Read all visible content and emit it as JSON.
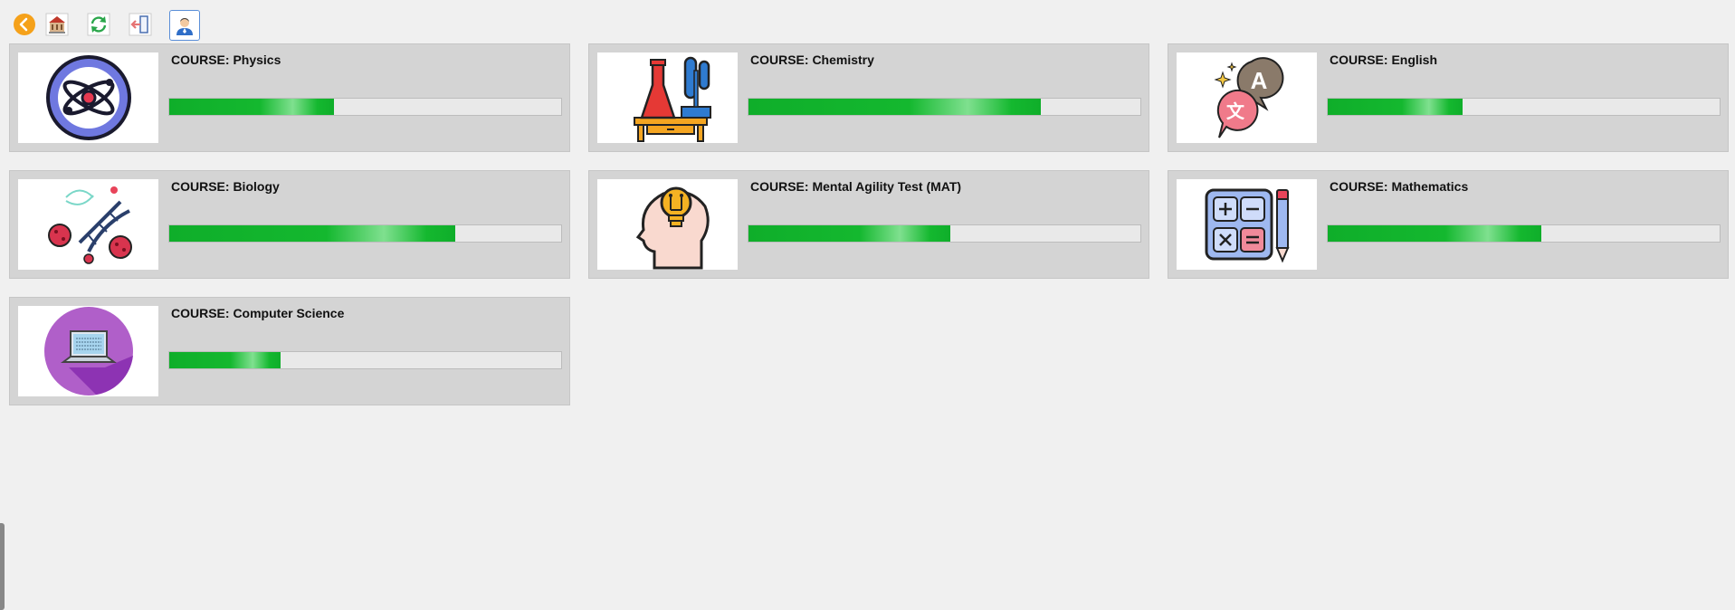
{
  "toolbar": {
    "buttons": [
      {
        "name": "back-button",
        "icon": "back-arrow-icon",
        "color": "#f5a11a"
      },
      {
        "name": "home-button",
        "icon": "school-building-icon",
        "color": "#c0392b"
      },
      {
        "name": "refresh-button",
        "icon": "refresh-icon",
        "color": "#2aa64a"
      },
      {
        "name": "logout-button",
        "icon": "exit-door-icon",
        "color": "#e57373"
      },
      {
        "name": "profile-button",
        "icon": "user-avatar-icon",
        "color": "#2f6ec8"
      }
    ]
  },
  "courses": [
    {
      "label": "COURSE: Physics",
      "icon": "atom-icon",
      "progress": 0.42
    },
    {
      "label": "COURSE: Chemistry",
      "icon": "lab-flask-icon",
      "progress": 0.745
    },
    {
      "label": "COURSE: English",
      "icon": "translate-speech-icon",
      "progress": 0.345
    },
    {
      "label": "COURSE: Biology",
      "icon": "dna-cells-icon",
      "progress": 0.73
    },
    {
      "label": "COURSE: Mental Agility Test (MAT)",
      "icon": "head-lightbulb-icon",
      "progress": 0.515
    },
    {
      "label": "COURSE: Mathematics",
      "icon": "calculator-icon",
      "progress": 0.545
    },
    {
      "label": "COURSE: Computer Science",
      "icon": "laptop-icon",
      "progress": 0.285
    }
  ],
  "colors": {
    "progress_fill": "#14b82f",
    "card_bg": "#d4d4d4",
    "page_bg": "#f0f0f0"
  }
}
